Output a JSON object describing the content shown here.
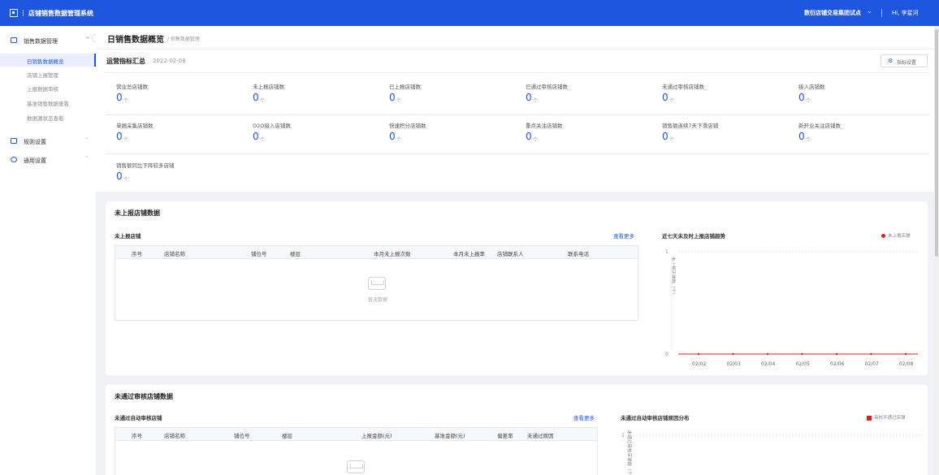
{
  "topbar": {
    "app_title": "店铺销售数据管理系统",
    "org_select": "数衍店铺交易集团试点",
    "user_greeting": "Hi, 李星河"
  },
  "sidebar": {
    "groups": [
      {
        "label": "销售数据管理",
        "icon": "chart-icon",
        "expanded": true
      },
      {
        "label": "规则设置",
        "icon": "rule-icon",
        "expanded": false
      },
      {
        "label": "通用设置",
        "icon": "gear-icon",
        "expanded": false
      }
    ],
    "items": [
      {
        "label": "日销售数据概览",
        "active": true
      },
      {
        "label": "店铺上报管理",
        "active": false
      },
      {
        "label": "上报数据审核",
        "active": false
      },
      {
        "label": "基准销售数据查看",
        "active": false
      },
      {
        "label": "数据源状态查看",
        "active": false
      }
    ]
  },
  "page": {
    "title": "日销售数据概览",
    "breadcrumb": "/ 销售数据管理"
  },
  "summary": {
    "title": "运营指标汇总",
    "date": "2022-02-08",
    "settings_button": "指标设置",
    "unit": "个",
    "metrics": [
      {
        "label": "营业总店铺数",
        "value": "0"
      },
      {
        "label": "未上报店铺数",
        "value": "0"
      },
      {
        "label": "已上报店铺数",
        "value": "0"
      },
      {
        "label": "已通过审核店铺数",
        "value": "0"
      },
      {
        "label": "未通过审核店铺数",
        "value": "0"
      },
      {
        "label": "接入店铺数",
        "value": "0"
      },
      {
        "label": "单据采集店铺数",
        "value": "0"
      },
      {
        "label": "O2O接入店铺数",
        "value": "0"
      },
      {
        "label": "快速积分店铺数",
        "value": "0"
      },
      {
        "label": "重点关注店铺数",
        "value": "0"
      },
      {
        "label": "销售额连续7天下滑店铺",
        "value": "0"
      },
      {
        "label": "新开业关注店铺数",
        "value": "0"
      },
      {
        "label": "销售额同比下降较多店铺",
        "value": "0"
      }
    ]
  },
  "unreported": {
    "section_title": "未上报店铺数据",
    "table_title": "未上报店铺",
    "more_link": "查看更多",
    "columns": [
      "序号",
      "店铺名称",
      "铺位号",
      "楼层",
      "本月未上报次数",
      "本月未上报率",
      "店铺联系人",
      "联系电话"
    ],
    "empty_text": "暂无数据",
    "chart": {
      "title": "近七天未及时上报店铺趋势",
      "legend": "未上报店铺"
    }
  },
  "failed_audit": {
    "section_title": "未通过审核店铺数据",
    "table_title": "未通过自动审核店铺",
    "more_link": "查看更多",
    "columns": [
      "序号",
      "店铺名称",
      "铺位号",
      "楼层",
      "上报金额(元)",
      "基准金额(元)",
      "偏差率",
      "未通过原因"
    ],
    "chart": {
      "title": "未通过自动审核店铺原因分布",
      "legend": "审核不通过店铺"
    }
  },
  "chart_data": [
    {
      "type": "line",
      "title": "近七天未及时上报店铺趋势",
      "ylabel": "未上报店铺数（个）",
      "x": [
        "02/02",
        "02/03",
        "02/04",
        "02/05",
        "02/06",
        "02/07",
        "02/08"
      ],
      "series": [
        {
          "name": "未上报店铺",
          "values": [
            0,
            0,
            0,
            0,
            0,
            0,
            0
          ]
        }
      ],
      "ylim": [
        0,
        1
      ],
      "y_ticks": [
        "0",
        "1"
      ],
      "grid": true,
      "legend": "top-right",
      "color": "#e02020"
    },
    {
      "type": "bar",
      "title": "未通过自动审核店铺原因分布",
      "ylabel": "未通过审核店铺数（个）",
      "series": [
        {
          "name": "审核不通过店铺",
          "values": []
        }
      ],
      "y_ticks": [
        "1"
      ],
      "legend": "top-right",
      "color": "#e02020"
    }
  ]
}
